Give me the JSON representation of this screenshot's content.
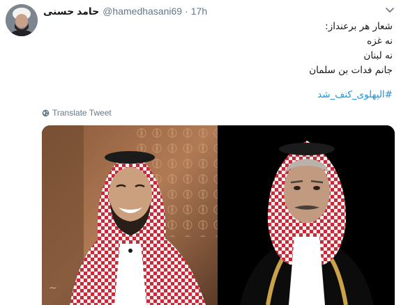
{
  "author": {
    "display_name": "حامد حسنی",
    "handle": "@hamedhasani69",
    "separator": "·",
    "time": "17h"
  },
  "tweet": {
    "lines": [
      "شعار هر برعنداز:",
      "نه غزه",
      "نه لبنان",
      "جانم فدات بن سلمان"
    ],
    "hashtag": "#الپهلوی_کنف_شد"
  },
  "translate": {
    "label": "Translate Tweet"
  },
  "media": {
    "photos": [
      {
        "subject": "smiling-man-in-keffiyeh"
      },
      {
        "subject": "serious-man-in-keffiyeh"
      }
    ]
  },
  "colors": {
    "link": "#1b95e0",
    "secondary_text": "#657786",
    "primary_text": "#14171a"
  }
}
